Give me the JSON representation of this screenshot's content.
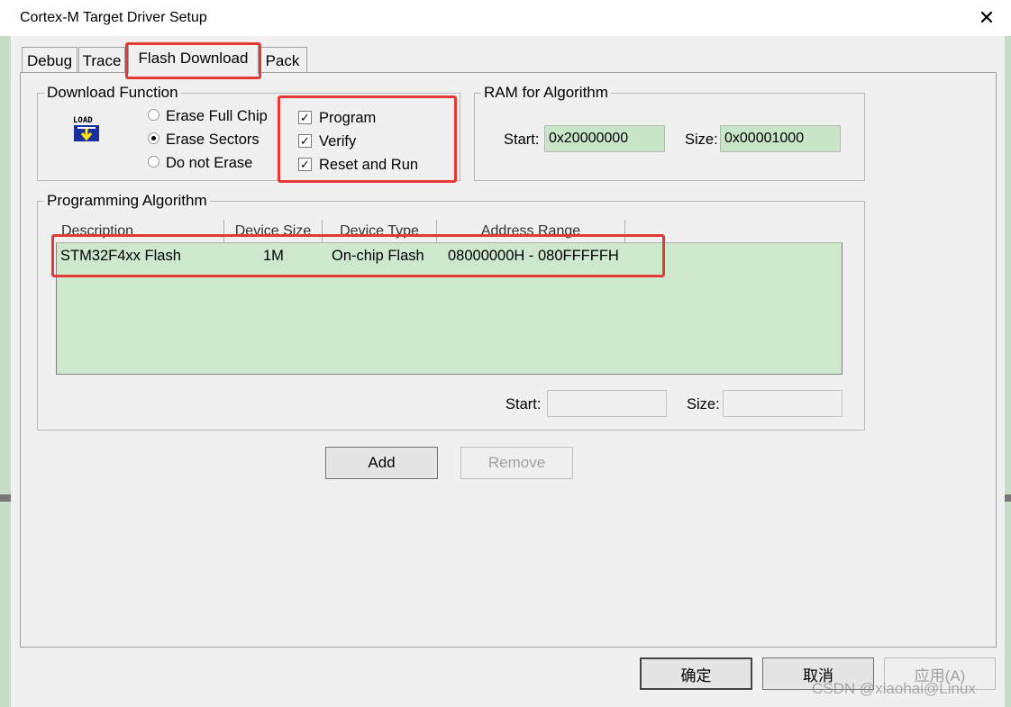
{
  "window": {
    "title": "Cortex-M Target Driver Setup",
    "close_glyph": "✕"
  },
  "tabs": [
    {
      "label": "Debug",
      "active": false
    },
    {
      "label": "Trace",
      "active": false
    },
    {
      "label": "Flash Download",
      "active": true
    },
    {
      "label": "Pack",
      "active": false
    }
  ],
  "download_function": {
    "title": "Download Function",
    "icon": "load-icon",
    "icon_text": "LOAD",
    "erase_options": [
      {
        "label": "Erase Full Chip",
        "selected": false
      },
      {
        "label": "Erase Sectors",
        "selected": true
      },
      {
        "label": "Do not Erase",
        "selected": false
      }
    ],
    "checks": [
      {
        "label": "Program",
        "checked": true
      },
      {
        "label": "Verify",
        "checked": true
      },
      {
        "label": "Reset and Run",
        "checked": true
      }
    ]
  },
  "ram": {
    "title": "RAM for Algorithm",
    "start_label": "Start:",
    "start_value": "0x20000000",
    "size_label": "Size:",
    "size_value": "0x00001000"
  },
  "programming_algorithm": {
    "title": "Programming Algorithm",
    "columns": [
      "Description",
      "Device Size",
      "Device Type",
      "Address Range"
    ],
    "rows": [
      {
        "description": "STM32F4xx Flash",
        "device_size": "1M",
        "device_type": "On-chip Flash",
        "address_range": "08000000H - 080FFFFFH"
      }
    ],
    "start_label": "Start:",
    "start_value": "",
    "size_label": "Size:",
    "size_value": ""
  },
  "buttons": {
    "add": "Add",
    "remove": "Remove",
    "ok": "确定",
    "cancel": "取消",
    "apply": "应用(A)"
  },
  "watermark": "CSDN @xiaohai@Linux",
  "colors": {
    "field_green": "#c9e6c9",
    "list_green": "#cde8cd",
    "highlight_red": "#e53935"
  }
}
